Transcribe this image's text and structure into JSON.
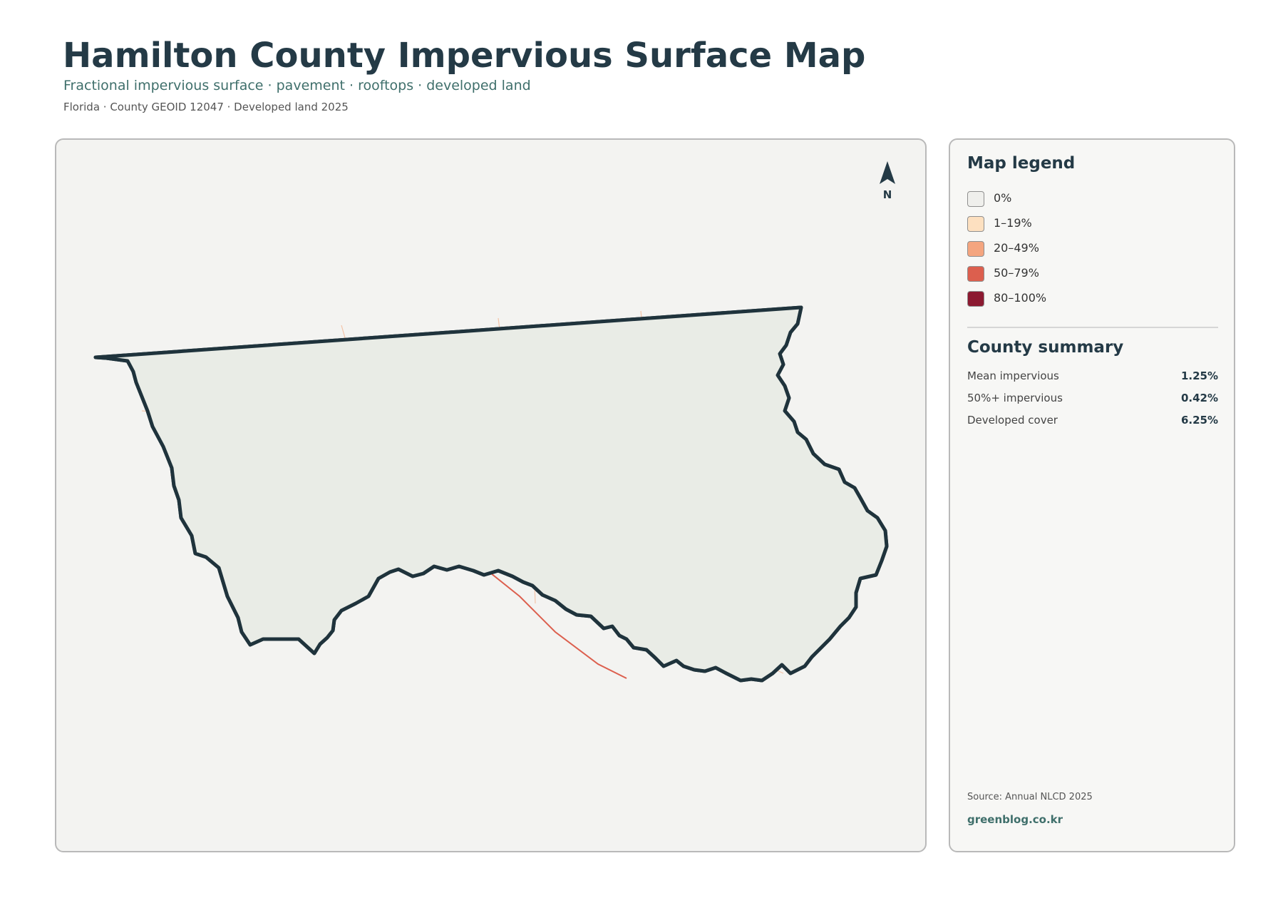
{
  "header": {
    "title": "Hamilton County Impervious Surface Map",
    "subtitle": "Fractional impervious surface · pavement · rooftops · developed land",
    "meta": "Florida · County GEOID 12047 · Developed land 2025"
  },
  "map": {
    "north_label": "N",
    "county_fill": "#e9ece6",
    "boundary_color": "#1f333c"
  },
  "legend": {
    "title": "Map legend",
    "items": [
      {
        "label": "0%",
        "color": "#efefec"
      },
      {
        "label": "1–19%",
        "color": "#fde0c0"
      },
      {
        "label": "20–49%",
        "color": "#f4a57f"
      },
      {
        "label": "50–79%",
        "color": "#dc5f4e"
      },
      {
        "label": "80–100%",
        "color": "#8c1a31"
      }
    ]
  },
  "summary": {
    "title": "County summary",
    "rows": [
      {
        "label": "Mean impervious",
        "value": "1.25%"
      },
      {
        "label": "50%+ impervious",
        "value": "0.42%"
      },
      {
        "label": "Developed cover",
        "value": "6.25%"
      }
    ]
  },
  "footer": {
    "source": "Source: Annual NLCD 2025",
    "brand": "greenblog.co.kr"
  }
}
